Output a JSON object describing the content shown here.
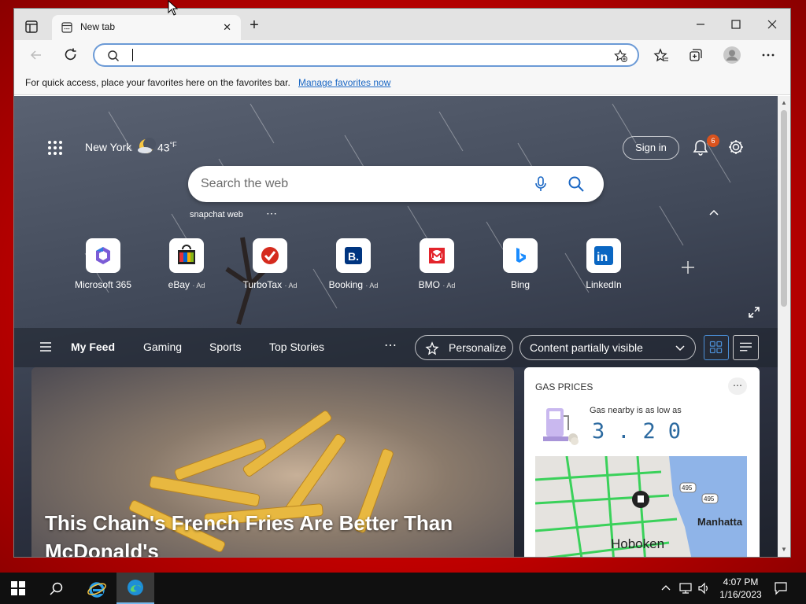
{
  "browser": {
    "tab_title": "New tab",
    "close_glyph": "✕",
    "new_tab_glyph": "+",
    "address_placeholder": "",
    "favbar_message": "For quick access, place your favorites here on the favorites bar.",
    "favbar_link": "Manage favorites now"
  },
  "header": {
    "city": "New York",
    "temperature": "43",
    "temp_unit": "°F",
    "sign_in": "Sign in",
    "notification_count": "6"
  },
  "search": {
    "placeholder": "Search the web",
    "trending": "snapchat web",
    "more": "⋯"
  },
  "tiles": [
    {
      "label": "Microsoft 365",
      "ad": ""
    },
    {
      "label": "eBay",
      "ad": "· Ad"
    },
    {
      "label": "TurboTax",
      "ad": "· Ad"
    },
    {
      "label": "Booking",
      "ad": "· Ad"
    },
    {
      "label": "BMO",
      "ad": "· Ad"
    },
    {
      "label": "Bing",
      "ad": ""
    },
    {
      "label": "LinkedIn",
      "ad": ""
    }
  ],
  "tile_glyphs": {
    "booking": "B.",
    "linkedin": "in"
  },
  "feed": {
    "tabs": [
      "My Feed",
      "Gaming",
      "Sports",
      "Top Stories"
    ],
    "more": "⋯",
    "personalize": "Personalize",
    "content_visibility": "Content partially visible"
  },
  "hero": {
    "headline": "This Chain's French Fries Are Better Than McDonald's"
  },
  "gas": {
    "title": "GAS PRICES",
    "subtitle": "Gas nearby is as low as",
    "price": "3.20",
    "more": "⋯",
    "map_city": "Hoboken",
    "map_city2": "Manhatta",
    "map_route": "495"
  },
  "taskbar": {
    "time": "4:07 PM",
    "date": "1/16/2023"
  },
  "colors": {
    "accent": "#1a67c4",
    "badge": "#d9531e",
    "gas_price": "#2c6aa0",
    "desktop": "#d40000"
  }
}
